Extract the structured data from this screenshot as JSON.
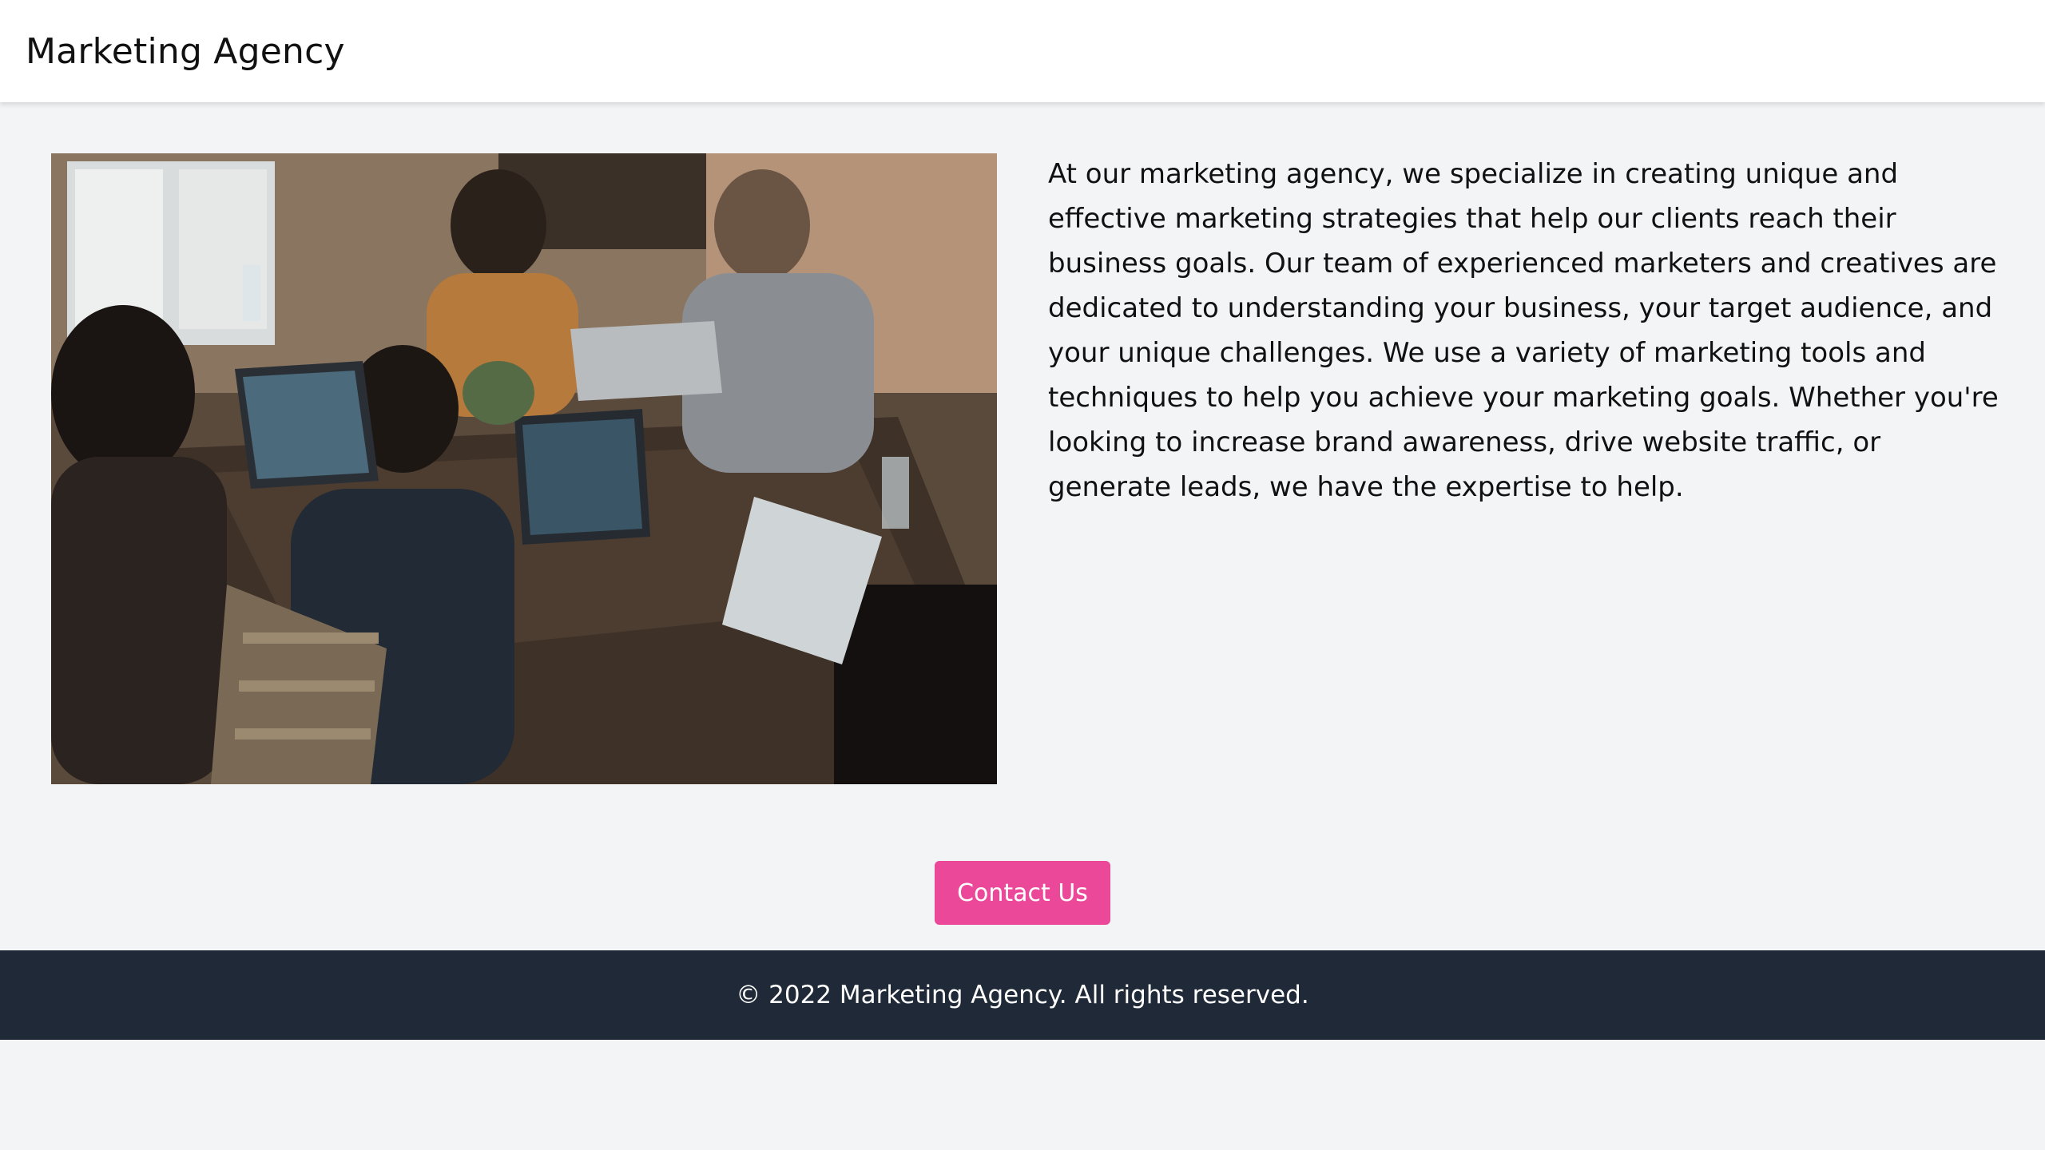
{
  "header": {
    "brand": "Marketing Agency"
  },
  "main": {
    "image_alt": "team working on laptops around a table",
    "description": "At our marketing agency, we specialize in creating unique and effective marketing strategies that help our clients reach their business goals. Our team of experienced marketers and creatives are dedicated to understanding your business, your target audience, and your unique challenges. We use a variety of marketing tools and techniques to help you achieve your marketing goals. Whether you're looking to increase brand awareness, drive website traffic, or generate leads, we have the expertise to help."
  },
  "cta": {
    "label": "Contact Us"
  },
  "footer": {
    "text": "© 2022 Marketing Agency. All rights reserved."
  },
  "colors": {
    "background": "#f3f4f6",
    "navbar": "#ffffff",
    "accent": "#ec4899",
    "footer": "#1f2937"
  }
}
